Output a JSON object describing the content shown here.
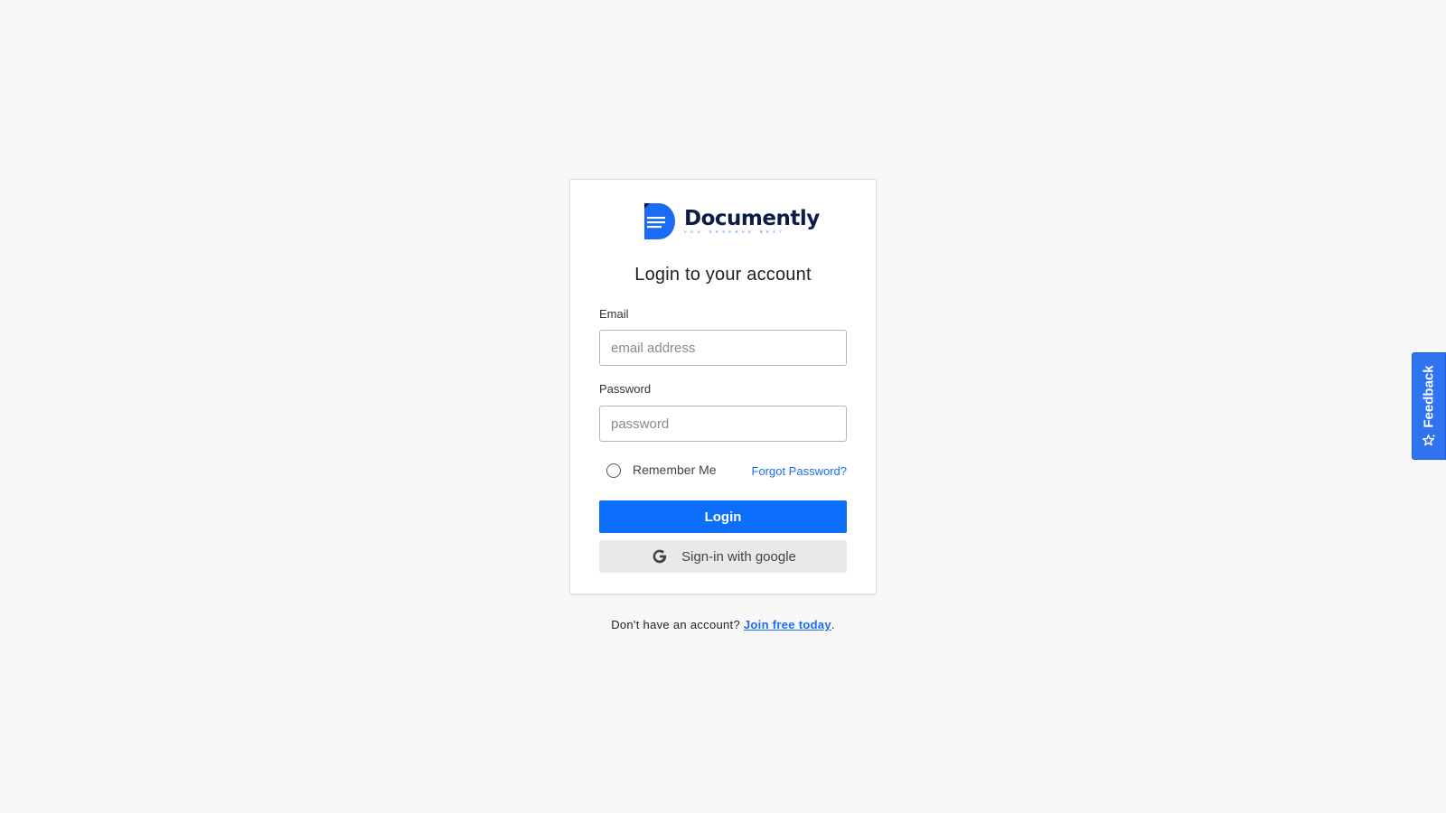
{
  "brand": {
    "name": "Documently",
    "tagline": "YOU DESERVE BEST",
    "logo_icon": "document-icon",
    "primary_color": "#0d6efd",
    "dark_color": "#0d1b4b"
  },
  "login": {
    "title": "Login to your account",
    "email_label": "Email",
    "email_placeholder": "email address",
    "email_value": "",
    "password_label": "Password",
    "password_placeholder": "password",
    "password_value": "",
    "remember_label": "Remember Me",
    "remember_checked": false,
    "forgot_label": "Forgot Password?",
    "login_button": "Login",
    "google_button": "Sign-in with google",
    "google_icon": "google-g-icon"
  },
  "signup": {
    "prompt": "Don't have an account?",
    "link": "Join free today",
    "suffix": "."
  },
  "feedback": {
    "label": "Feedback",
    "icon": "star-sparkle-icon",
    "color": "#2f73f0"
  }
}
